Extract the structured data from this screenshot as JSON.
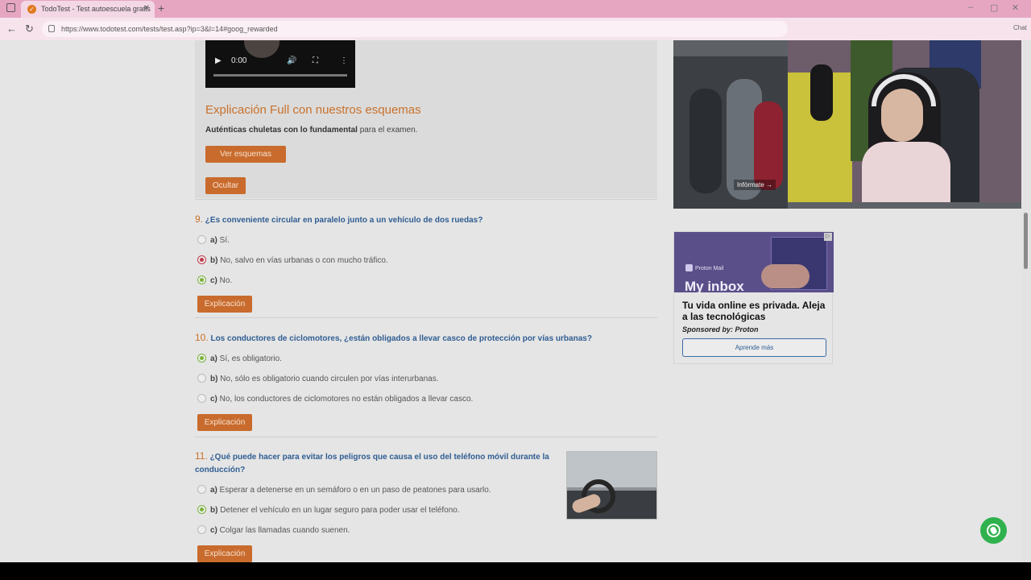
{
  "browser": {
    "tab_title": "TodoTest - Test autoescuela gratis",
    "tab_favicon": "✓",
    "new_tab": "+",
    "url": "https://www.todotest.com/tests/test.asp?ip=3&l=14#goog_rewarded",
    "chat_label": "Chat"
  },
  "video": {
    "time": "0:00"
  },
  "explanation_card": {
    "title": "Explicación Full con nuestros esquemas",
    "text_bold": "Auténticas chuletas con lo fundamental",
    "text_rest": " para el examen.",
    "view_button": "Ver esquemas",
    "hide_button": "Ocultar"
  },
  "questions": [
    {
      "number": "9.",
      "text": "¿Es conveniente circular en paralelo junto a un vehículo de dos ruedas?",
      "options": [
        {
          "letter": "a)",
          "text": " Sí.",
          "state": "none"
        },
        {
          "letter": "b)",
          "text": " No, salvo en vías urbanas o con mucho tráfico.",
          "state": "wrong"
        },
        {
          "letter": "c)",
          "text": " No.",
          "state": "correct"
        }
      ],
      "button": "Explicación"
    },
    {
      "number": "10.",
      "text": "Los conductores de ciclomotores, ¿están obligados a llevar casco de protección por vías urbanas?",
      "options": [
        {
          "letter": "a)",
          "text": " Sí, es obligatorio.",
          "state": "correct"
        },
        {
          "letter": "b)",
          "text": " No, sólo es obligatorio cuando circulen por vías interurbanas.",
          "state": "none"
        },
        {
          "letter": "c)",
          "text": " No, los conductores de ciclomotores no están obligados a llevar casco.",
          "state": "none"
        }
      ],
      "button": "Explicación"
    },
    {
      "number": "11.",
      "text": "¿Qué puede hacer para evitar los peligros que causa el uso del teléfono móvil durante la conducción?",
      "options": [
        {
          "letter": "a)",
          "text": " Esperar a detenerse en un semáforo o en un paso de peatones para usarlo.",
          "state": "none"
        },
        {
          "letter": "b)",
          "text": " Detener el vehículo en un lugar seguro para poder usar el teléfono.",
          "state": "correct"
        },
        {
          "letter": "c)",
          "text": " Colgar las llamadas cuando suenen.",
          "state": "none"
        }
      ],
      "button": "Explicación"
    }
  ],
  "sidebar_ad_photo": {
    "cta": "Infórmate →"
  },
  "proton_ad": {
    "brand": "Proton Mail",
    "image_headline": "My inbox",
    "title": "Tu vida online es privada. Aleja a las tecnológicas",
    "sponsor": "Sponsored by: Proton",
    "button": "Aprende más"
  },
  "colors": {
    "accent_orange": "#c86b2d",
    "question_blue": "#2f5d92",
    "correct_green": "#7bb33a",
    "wrong_red": "#c0394a",
    "whatsapp_green": "#2fb24d"
  }
}
